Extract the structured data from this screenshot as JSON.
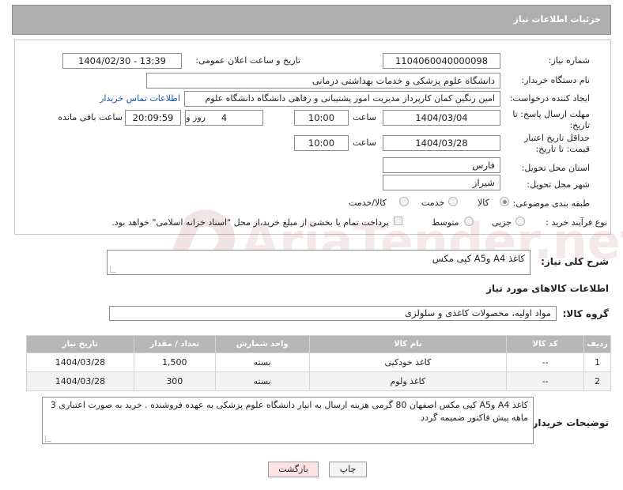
{
  "header": {
    "title": "جزئیات اطلاعات نیاز"
  },
  "fields": {
    "need_number_label": "شماره نیاز:",
    "need_number": "1104060040000098",
    "announce_label": "تاریخ و ساعت اعلان عمومی:",
    "announce_value": "1404/02/30 - 13:39",
    "buyer_org_label": "نام دستگاه خریدار:",
    "buyer_org": "دانشگاه علوم پزشکی و خدمات بهداشتی درمانی",
    "creator_label": "ایجاد کننده درخواست:",
    "creator": "امین رنگین کمان کارپرداز مدیریت امور پشتیبانی و رفاهی دانشگاه دانشگاه علوم",
    "contact_link": "اطلاعات تماس خریدار",
    "reply_deadline_label": "مهلت ارسال پاسخ: تا تاریخ:",
    "reply_date": "1404/03/04",
    "time_label": "ساعت",
    "reply_time": "10:00",
    "days_value": "4",
    "days_label": "روز و",
    "remaining_time": "20:09:59",
    "remaining_label": "ساعت باقی مانده",
    "price_validity_label": "حداقل تاریخ اعتبار قیمت: تا تاریخ:",
    "validity_date": "1404/03/28",
    "validity_time": "10:00",
    "province_label": "استان محل تحویل:",
    "province": "فارس",
    "city_label": "شهر محل تحویل:",
    "city": "شیراز",
    "category_label": "طبقه بندی موضوعی:",
    "category_options": [
      "کالا",
      "خدمت",
      "کالا/خدمت"
    ],
    "process_label": "نوع فرآیند خرید :",
    "process_options": [
      "جزیی",
      "متوسط"
    ],
    "payment_note": "پرداخت تمام یا بخشی از مبلغ خرید،از محل \"اسناد خزانه اسلامی\" خواهد بود."
  },
  "summary": {
    "label": "شرح کلی نیاز:",
    "value": "کاغذ A4 وA5 کپی مکس"
  },
  "goods_section": {
    "title": "اطلاعات کالاهای مورد نیاز",
    "group_label": "گروه کالا:",
    "group_value": "مواد اولیه، محصولات کاغذی و سلولزی"
  },
  "table": {
    "headers": [
      "ردیف",
      "کد کالا",
      "نام کالا",
      "واحد شمارش",
      "تعداد / مقدار",
      "تاریخ نیاز"
    ],
    "rows": [
      [
        "1",
        "--",
        "کاغذ خودکپی",
        "بسته",
        "1,500",
        "1404/03/28"
      ],
      [
        "2",
        "--",
        "کاغذ ولوم",
        "بسته",
        "300",
        "1404/03/28"
      ]
    ]
  },
  "buyer_notes": {
    "label": "توضیحات خریدار:",
    "value": "کاغذ A4 وA5 کپی مکس اصفهان 80 گرمی هزینه ارسال به انبار دانشگاه علوم پزشکی به عهده فروشنده . خرید به صورت اعتباری 3 ماهه پیش فاکتور ضمیمه گردد"
  },
  "buttons": {
    "print": "چاپ",
    "back": "بازگشت"
  },
  "watermark": {
    "text": "AriaTender.net"
  },
  "colors": {
    "header_bg": "#aeaeae",
    "link": "#1a55a8",
    "back_btn": "#fde3e3"
  }
}
